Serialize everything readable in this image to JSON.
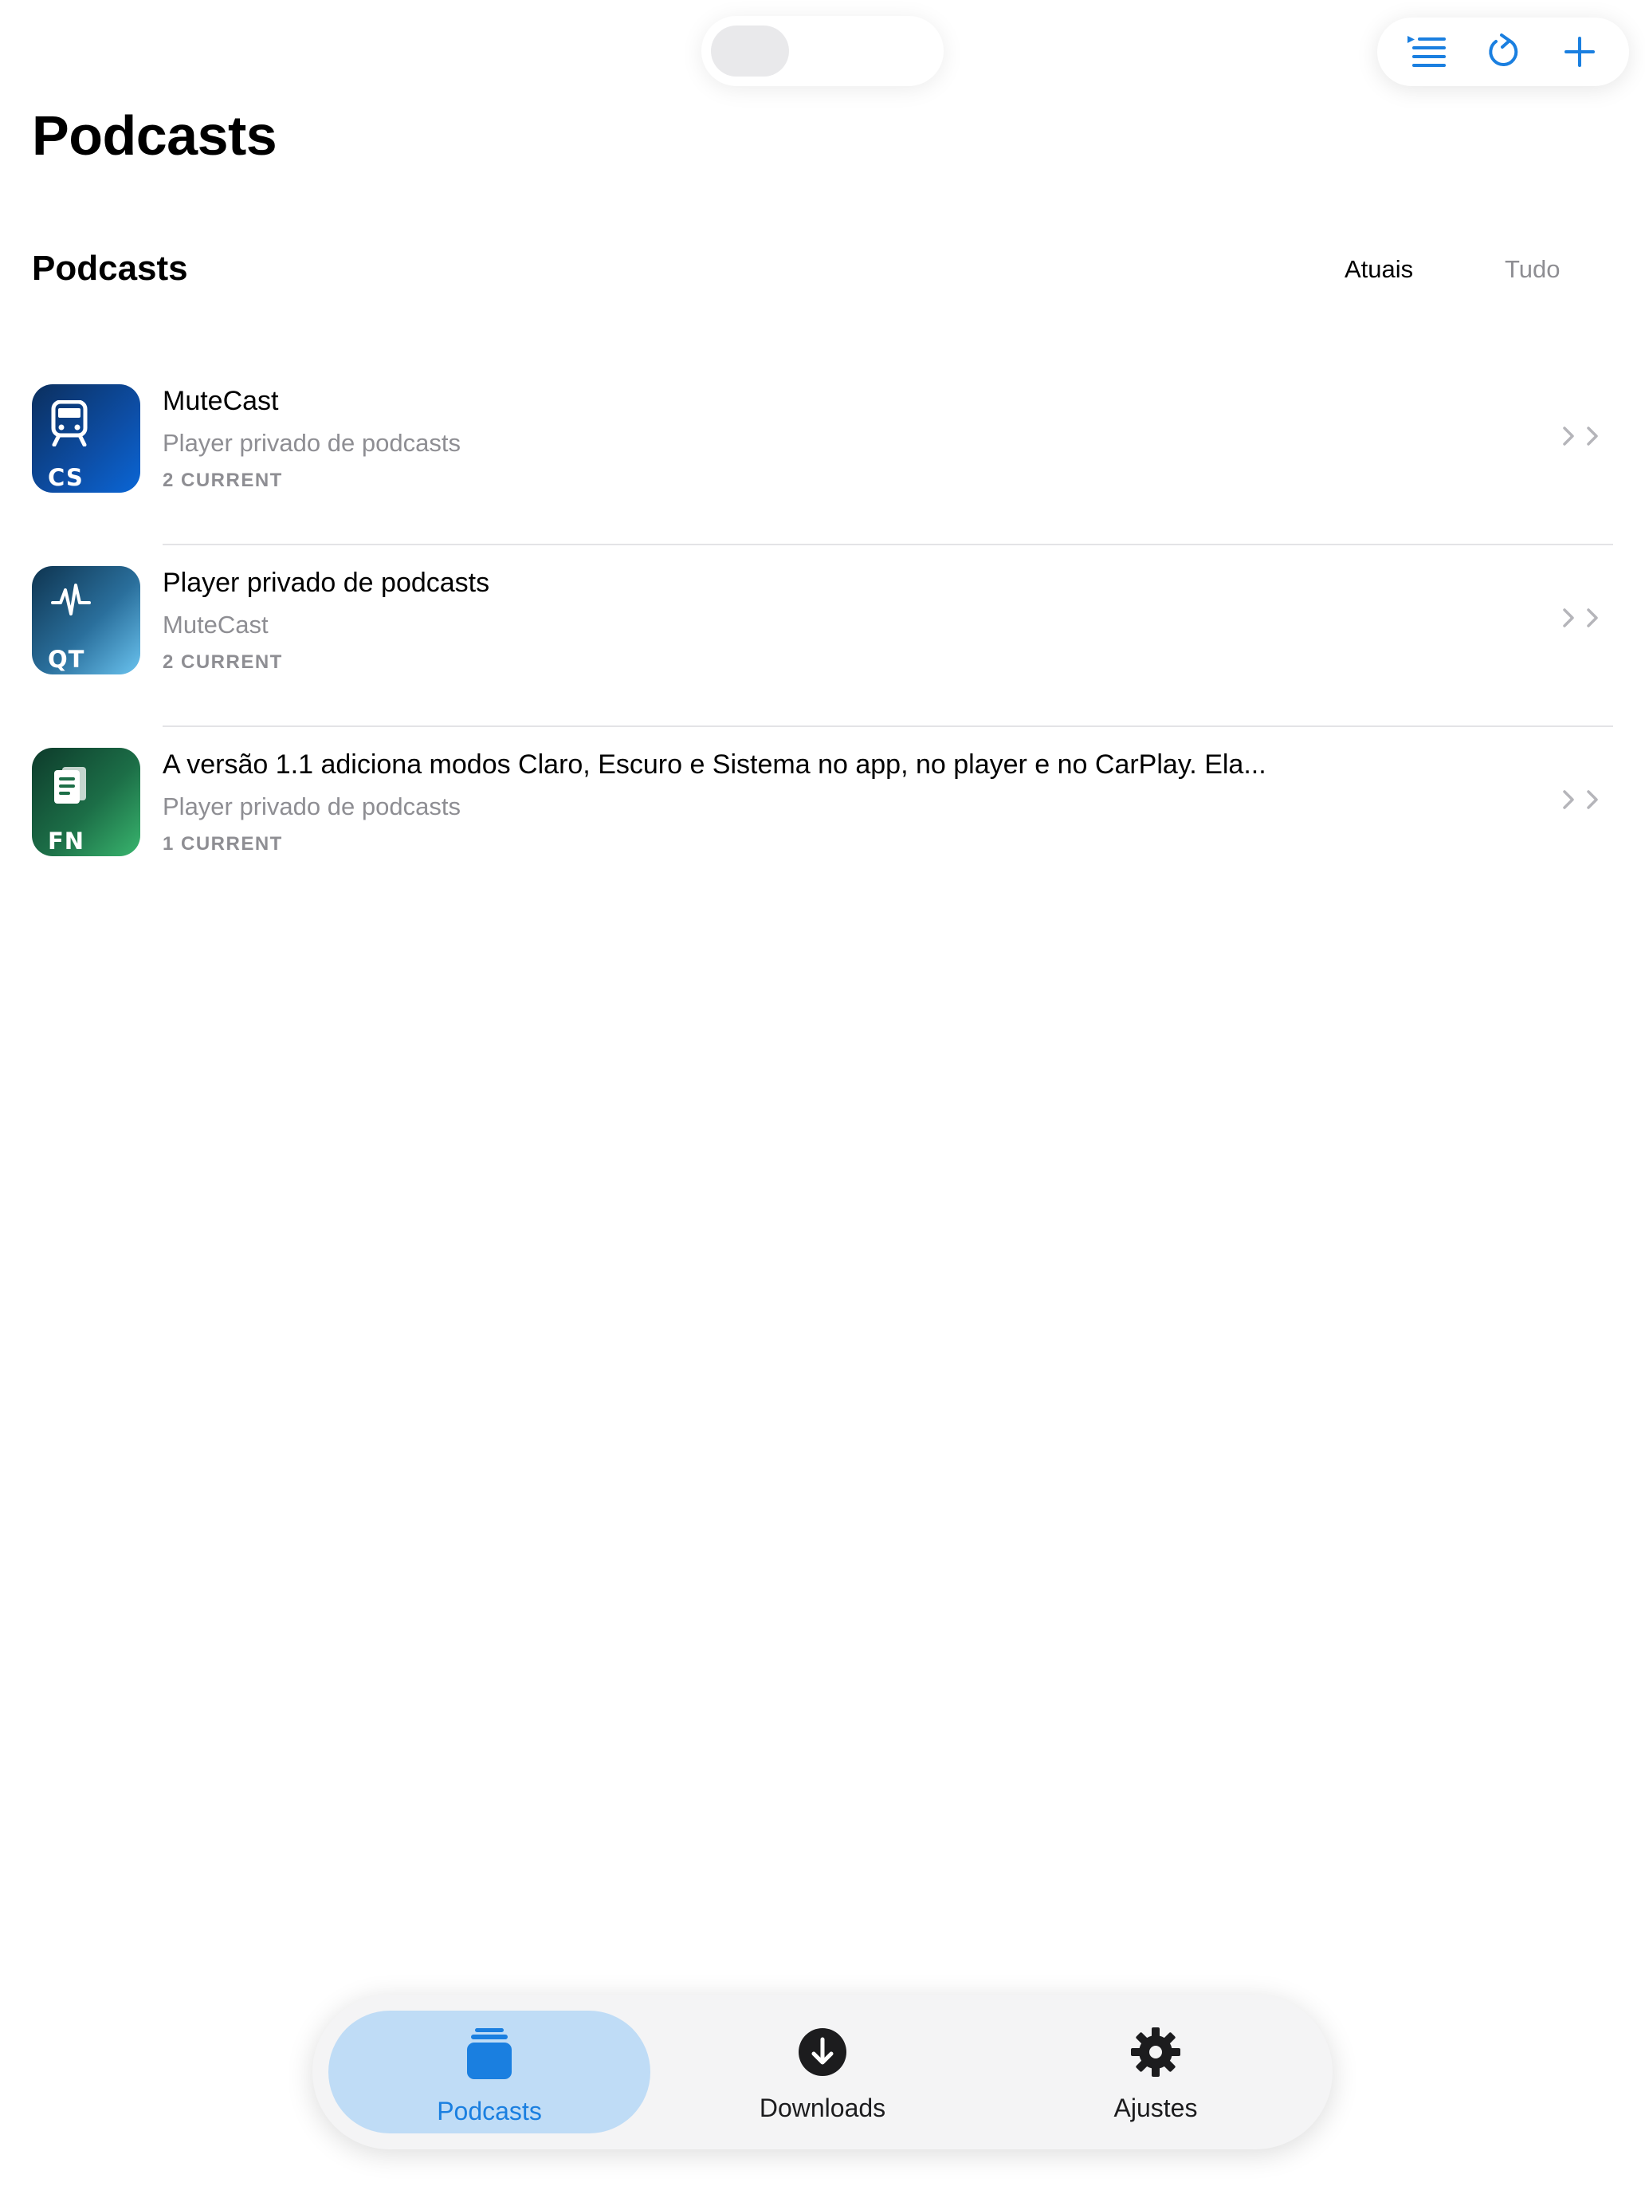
{
  "nav": {
    "large_title": "Podcasts"
  },
  "toolbar": {
    "buttons": [
      {
        "icon": "queue-list-icon"
      },
      {
        "icon": "refresh-icon"
      },
      {
        "icon": "add-icon"
      }
    ],
    "accent": "#1a7fe0"
  },
  "section": {
    "title": "Podcasts",
    "segments": [
      {
        "label": "Atuais",
        "selected": true
      },
      {
        "label": "Tudo",
        "selected": false
      }
    ]
  },
  "podcasts": [
    {
      "title": "MuteCast",
      "subtitle": "Player privado de podcasts",
      "meta": "2 CURRENT",
      "abbr": "CS",
      "icon": "train-icon"
    },
    {
      "title": "Player privado de podcasts",
      "subtitle": "MuteCast",
      "meta": "2 CURRENT",
      "abbr": "QT",
      "icon": "waveform-icon"
    },
    {
      "title": "A versão 1.1 adiciona modos Claro, Escuro e Sistema no app, no player e no CarPlay. Ela...",
      "subtitle": "Player privado de podcasts",
      "meta": "1 CURRENT",
      "abbr": "FN",
      "icon": "document-icon"
    }
  ],
  "tabbar": {
    "tabs": [
      {
        "label": "Podcasts",
        "icon": "stack-icon",
        "selected": true
      },
      {
        "label": "Downloads",
        "icon": "download-circle-icon",
        "selected": false
      },
      {
        "label": "Ajustes",
        "icon": "gear-icon",
        "selected": false
      }
    ]
  }
}
